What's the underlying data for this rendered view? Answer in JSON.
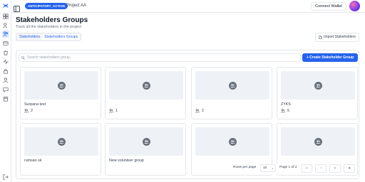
{
  "topbar": {
    "badge": "ANTICIPATORY_ACTION",
    "project": "Project AA",
    "connect_wallet": "Connect Wallet"
  },
  "page": {
    "title": "Stakeholders Groups",
    "subtitle": "Track all the stakeholders in the project"
  },
  "tabs": [
    {
      "label": "Stakeholders"
    },
    {
      "label": "Stakeholders Groups"
    }
  ],
  "import_button": "Import Stakeholders",
  "search": {
    "placeholder": "Search stakeholders group..."
  },
  "create_button": "+ Create Stakeholder Group",
  "groups": [
    {
      "name": "Surpana test",
      "count": "2"
    },
    {
      "name": "",
      "count": "1"
    },
    {
      "name": "",
      "count": "2"
    },
    {
      "name": "ZYKS",
      "count": "5"
    },
    {
      "name": "rumsan sk",
      "count": ""
    },
    {
      "name": "New volunteer group",
      "count": ""
    },
    {
      "name": "",
      "count": "1"
    },
    {
      "name": "",
      "count": "1"
    }
  ],
  "pagination": {
    "rows_label": "Rows per page",
    "rows_value": "10",
    "page_label": "Page 1 of 2",
    "first": "«",
    "prev": "‹",
    "next": "›",
    "last": "»"
  },
  "colors": {
    "accent": "#2563eb",
    "thumb": "#eef2f7"
  }
}
